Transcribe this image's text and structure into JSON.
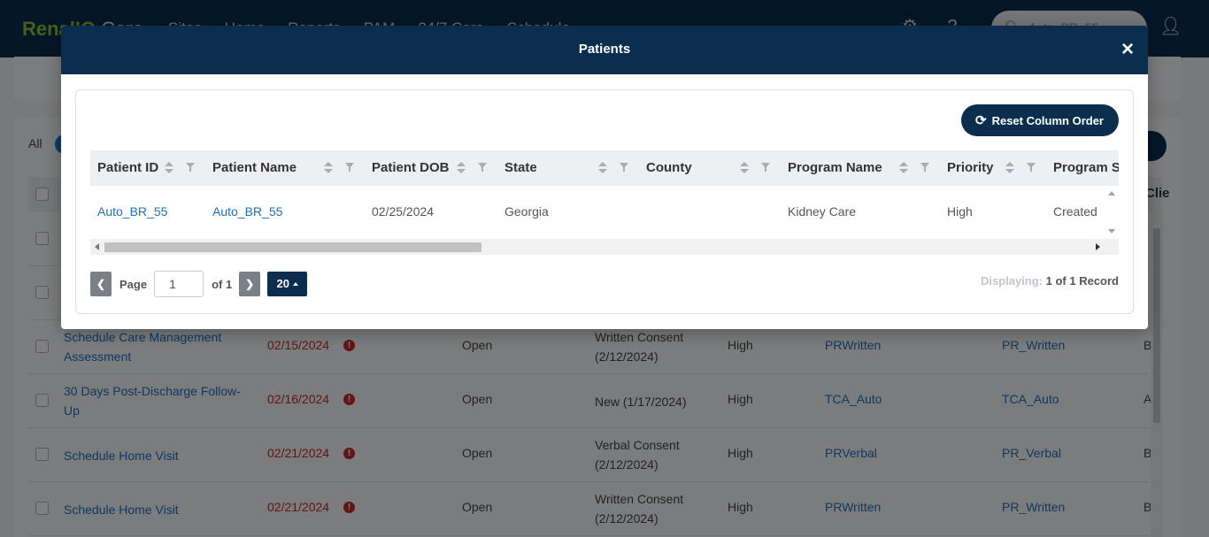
{
  "background": {
    "brand_primary": "RenalIQ",
    "brand_secondary": "Care",
    "nav_items": [
      "Sites",
      "Home",
      "Reports",
      "PAM",
      "24/7 Care",
      "Schedule"
    ],
    "search_value": "Auto_BR_55",
    "filter_all": "All",
    "column_partial": "Clie",
    "rows": [
      {
        "task": "Schedule Care Management Assessment",
        "due": "02/15/2024",
        "status": "Open",
        "consent": "Written Consent (2/12/2024)",
        "priority": "High",
        "program": "PRWritten",
        "program2": "PR_Written",
        "last": "B"
      },
      {
        "task": "30 Days Post-Discharge Follow-Up",
        "due": "02/16/2024",
        "status": "Open",
        "consent": "New (1/17/2024)",
        "priority": "High",
        "program": "TCA_Auto",
        "program2": "TCA_Auto",
        "last": "A"
      },
      {
        "task": "Schedule Home Visit",
        "due": "02/21/2024",
        "status": "Open",
        "consent": "Verbal Consent (2/12/2024)",
        "priority": "High",
        "program": "PRVerbal",
        "program2": "PR_Verbal",
        "last": "B"
      },
      {
        "task": "Schedule Home Visit",
        "due": "02/21/2024",
        "status": "Open",
        "consent": "Written Consent (2/12/2024)",
        "priority": "High",
        "program": "PRWritten",
        "program2": "PR_Written",
        "last": "B"
      }
    ]
  },
  "modal": {
    "title": "Patients",
    "close_symbol": "×",
    "reset_label": "Reset Column Order",
    "columns": [
      "Patient ID",
      "Patient Name",
      "Patient DOB",
      "State",
      "County",
      "Program Name",
      "Priority",
      "Program S"
    ],
    "row": {
      "patient_id": "Auto_BR_55",
      "patient_name": "Auto_BR_55",
      "dob": "02/25/2024",
      "state": "Georgia",
      "county": "",
      "program_name": "Kidney Care",
      "priority": "High",
      "program_status": "Created"
    },
    "pager": {
      "page_label": "Page",
      "page_value": "1",
      "of_label": "of 1",
      "page_size": "20",
      "displaying_label": "Displaying:",
      "displaying_value": "1 of 1 Record"
    }
  }
}
